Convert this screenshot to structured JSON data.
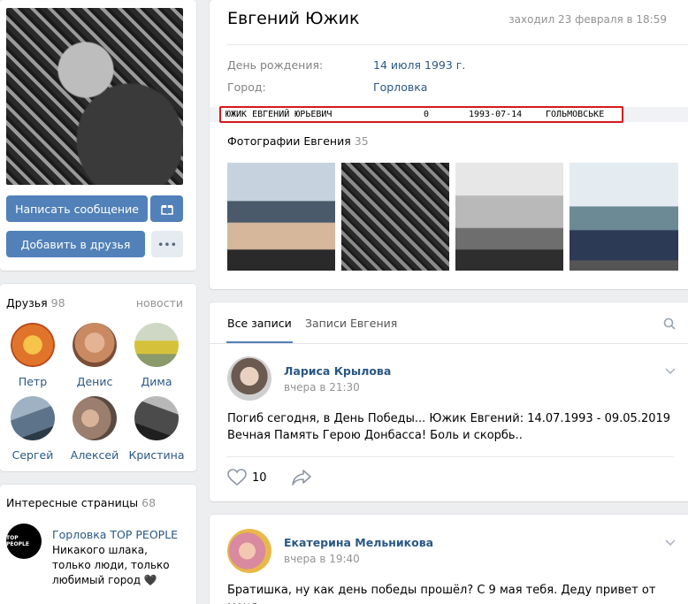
{
  "left": {
    "buttons": {
      "message": "Написать сообщение",
      "add_friend": "Добавить в друзья",
      "more": "•••"
    },
    "friends": {
      "title": "Друзья",
      "count": "98",
      "link": "новости",
      "items": [
        {
          "name": "Петр",
          "color": "#e0742a"
        },
        {
          "name": "Денис",
          "color": "#c98a62"
        },
        {
          "name": "Дима",
          "color": "#8a9a6a"
        },
        {
          "name": "Сергей",
          "color": "#5d7389"
        },
        {
          "name": "Алексей",
          "color": "#9b7e6d"
        },
        {
          "name": "Кристина",
          "color": "#4b4b4b"
        }
      ]
    },
    "interesting": {
      "title": "Интересные страницы",
      "count": "68",
      "pages": [
        {
          "name": "Горловка TOP PEOPLE",
          "logo": "TOP PEOPLE",
          "desc": "Никакого шлака, только люди, только любимый город 🖤"
        }
      ]
    }
  },
  "profile": {
    "name": "Евгений Южик",
    "last_seen": "заходил 23 февраля в 18:59",
    "birthday_label": "День рождения:",
    "birthday_value": "14 июля 1993 г.",
    "city_label": "Город:",
    "city_value": "Горловка",
    "overlay": {
      "full_name": "ЮЖИК ЕВГЕНИЙ ЮРЬЕВИЧ",
      "code": "0",
      "date": "1993-07-14",
      "place": "ГОЛЬМОВСЬКЕ"
    },
    "photos_title": "Фотографии Евгения",
    "photos_count": "35"
  },
  "wall": {
    "tabs": [
      "Все записи",
      "Записи Евгения"
    ],
    "posts": [
      {
        "author": "Лариса Крылова",
        "time": "вчера в 21:30",
        "text": "Погиб сегодня, в День Победы... Южик Евгений: 14.07.1993 - 09.05.2019 Вечная Память Герою Донбасса! Боль и скорбь..",
        "likes": "10"
      },
      {
        "author": "Екатерина Мельникова",
        "time": "вчера в 19:40",
        "text": "Братишка, ну как день победы прошёл? С 9 мая тебя. Деду привет от меня."
      }
    ]
  },
  "colors": {
    "link": "#2a5885",
    "button": "#5181b8",
    "highlight": "#d41a1a"
  }
}
